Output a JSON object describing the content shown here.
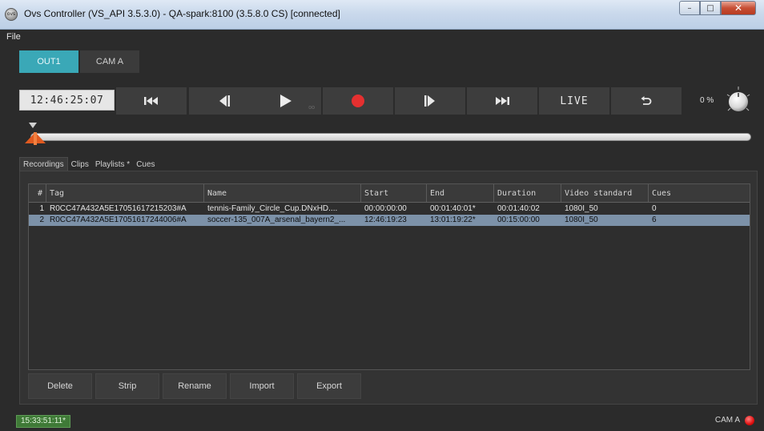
{
  "window": {
    "title": "Ovs Controller (VS_API 3.5.3.0) - QA-spark:8100 (3.5.8.0 CS) [connected]",
    "app_icon_text": "ovs",
    "minimize": "–",
    "maximize": "□",
    "close": "✕"
  },
  "menu": {
    "file": "File"
  },
  "outputs": {
    "active": "OUT1",
    "inactive": "CAM A"
  },
  "transport": {
    "timecode": "12:46:25:07",
    "live_label": "LIVE",
    "zoom": "0 %",
    "tiny_label": "oo"
  },
  "tabs": [
    {
      "label": "Recordings",
      "active": true
    },
    {
      "label": "Clips"
    },
    {
      "label": "Playlists *"
    },
    {
      "label": "Cues"
    }
  ],
  "table": {
    "columns": [
      "#",
      "Tag",
      "Name",
      "Start",
      "End",
      "Duration",
      "Video standard",
      "Cues"
    ],
    "rows": [
      {
        "num": "1",
        "tag": "R0CC47A432A5E17051617215203#A",
        "name": "tennis-Family_Circle_Cup.DNxHD....",
        "start": "00:00:00:00",
        "end": "00:01:40:01*",
        "duration": "00:01:40:02",
        "video_standard": "1080I_50",
        "cues": "0",
        "selected": false
      },
      {
        "num": "2",
        "tag": "R0CC47A432A5E17051617244006#A",
        "name": "soccer-135_007A_arsenal_bayern2_...",
        "start": "12:46:19:23",
        "end": "13:01:19:22*",
        "duration": "00:15:00:00",
        "video_standard": "1080I_50",
        "cues": "6",
        "selected": true
      }
    ]
  },
  "actions": {
    "delete": "Delete",
    "strip": "Strip",
    "rename": "Rename",
    "import": "Import",
    "export": "Export"
  },
  "status": {
    "time": "15:33:51:11*",
    "source": "CAM A",
    "indicator_color": "#e01010"
  },
  "colors": {
    "accent": "#3aa8b7",
    "selection": "#7c91a8",
    "record": "#e53030",
    "scrub_handle": "#e05a20"
  }
}
